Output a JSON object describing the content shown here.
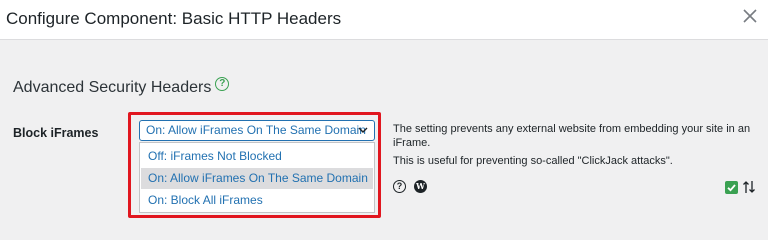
{
  "dialog": {
    "title": "Configure Component: Basic HTTP Headers",
    "close_icon": "close-icon"
  },
  "section": {
    "title": "Advanced Security Headers",
    "help_symbol": "?",
    "help_icon": "help-circle-icon"
  },
  "field": {
    "label": "Block iFrames",
    "selected": "On: Allow iFrames On The Same Domain",
    "options": [
      "Off: iFrames Not Blocked",
      "On: Allow iFrames On The Same Domain",
      "On: Block All iFrames"
    ],
    "description_line1": "The setting prevents any external website from embedding your site in an",
    "description_line2": "iFrame.",
    "description_line3": "This is useful for preventing so-called \"ClickJack attacks\".",
    "help_symbol": "?",
    "wp_symbol": "W"
  },
  "colors": {
    "accent": "#2271b1",
    "highlight_border": "#e1161f",
    "help_green": "#3aa152",
    "selected_bg": "#dcdcde"
  }
}
